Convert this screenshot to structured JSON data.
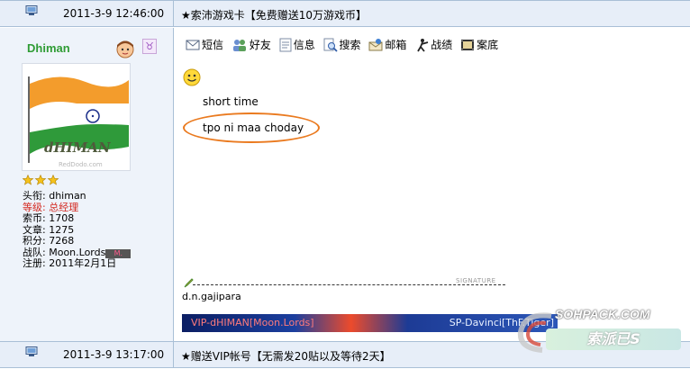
{
  "posts": [
    {
      "time": "2011-3-9 12:46:00",
      "ad": "★索沛游戏卡【免费赠送10万游戏币】"
    },
    {
      "time": "2011-3-9 13:17:00",
      "ad": "★赠送VIP帐号【无需发20贴以及等待2天】"
    }
  ],
  "user": {
    "name": "Dhiman",
    "avatar_text": "dHIMAN",
    "avatar_watermark": "RedDodo.com",
    "zodiac_symbol": "♉",
    "stars": 3,
    "rows": [
      {
        "label": "头衔:",
        "value": "dhiman"
      },
      {
        "label": "等级:",
        "value": "总经理"
      },
      {
        "label": "索币:",
        "value": "1708"
      },
      {
        "label": "文章:",
        "value": "1275"
      },
      {
        "label": "积分:",
        "value": "7268"
      },
      {
        "label": "战队:",
        "value": "Moon.Lords",
        "badge": "M."
      },
      {
        "label": "注册:",
        "value": "2011年2月1日"
      }
    ]
  },
  "toolbar": [
    {
      "label": "短信",
      "icon": "envelope-icon"
    },
    {
      "label": "好友",
      "icon": "friends-icon"
    },
    {
      "label": "信息",
      "icon": "info-icon"
    },
    {
      "label": "搜索",
      "icon": "search-icon"
    },
    {
      "label": "邮箱",
      "icon": "mail-icon"
    },
    {
      "label": "战绩",
      "icon": "shooter-icon"
    },
    {
      "label": "案底",
      "icon": "film-icon"
    }
  ],
  "message": {
    "line1": "short time",
    "line2": "tpo ni maa choday"
  },
  "signature": {
    "label": "SIGNATURE",
    "name": "d.n.gajipara",
    "banner_left": "VIP-dHIMAN[Moon.Lords]",
    "banner_right": "SP-Davinci[ThF.Tiger]"
  },
  "watermark": {
    "top": "SOHPACK.COM",
    "bottom": "索派已S"
  },
  "colors": {
    "username": "#2f9c35",
    "highlight_ellipse": "#ea7a1f",
    "bar_bg": "#e7eef8",
    "left_bg": "#eef3fa",
    "rank_red": "#d3281f"
  }
}
